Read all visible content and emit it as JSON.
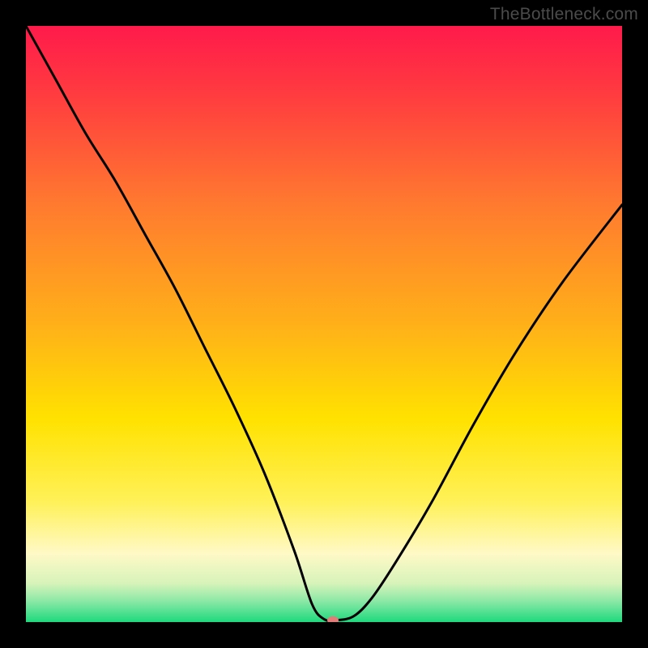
{
  "watermark": "TheBottleneck.com",
  "chart_data": {
    "type": "line",
    "title": "",
    "xlabel": "",
    "ylabel": "",
    "xlim": [
      0,
      100
    ],
    "ylim": [
      0,
      100
    ],
    "background_gradient": [
      {
        "stop": 0.0,
        "color": "#ff1a4b"
      },
      {
        "stop": 0.12,
        "color": "#ff3d3f"
      },
      {
        "stop": 0.3,
        "color": "#ff7a2f"
      },
      {
        "stop": 0.5,
        "color": "#ffb019"
      },
      {
        "stop": 0.66,
        "color": "#ffe200"
      },
      {
        "stop": 0.8,
        "color": "#fff15a"
      },
      {
        "stop": 0.885,
        "color": "#fff9c6"
      },
      {
        "stop": 0.935,
        "color": "#d7f3ba"
      },
      {
        "stop": 0.965,
        "color": "#8be8a6"
      },
      {
        "stop": 1.0,
        "color": "#1ed97d"
      }
    ],
    "series": [
      {
        "name": "bottleneck-curve",
        "color": "#000000",
        "x": [
          0,
          5,
          10,
          15,
          20,
          25,
          30,
          35,
          40,
          45,
          48,
          50,
          52,
          55,
          58,
          62,
          68,
          75,
          82,
          90,
          100
        ],
        "y": [
          100,
          91,
          82,
          74,
          65,
          56,
          46,
          36,
          25,
          12,
          3,
          0.5,
          0.3,
          1,
          4,
          10,
          20,
          33,
          45,
          57,
          70
        ]
      }
    ],
    "marker": {
      "x": 51.5,
      "y": 0.3,
      "color": "#e37b78",
      "rx": 7,
      "ry": 5
    }
  }
}
